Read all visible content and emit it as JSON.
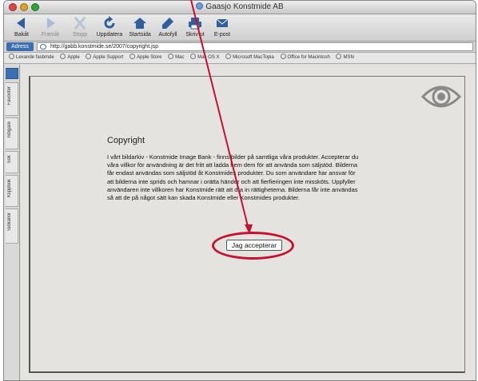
{
  "window": {
    "title": "Gaasjo Konstmide AB",
    "traffic_light_colors": [
      "#e0443e",
      "#dea123",
      "#2ea334"
    ]
  },
  "toolbar": {
    "back": "Bakåt",
    "forward": "Framåt",
    "stop": "Stopp",
    "refresh": "Uppdatera",
    "home": "Startsida",
    "autofill": "Autofyll",
    "print": "Skriv ut",
    "mail": "E-post"
  },
  "address": {
    "label": "Adress",
    "url": "http://gabb.konstmide.se/2007/copyright.jsp"
  },
  "favorites": [
    "Levande fasbmde",
    "Apple",
    "Apple Support",
    "Apple Store",
    "Mac",
    "Mac OS X",
    "Microsoft MacTopia",
    "Office for Macintosh",
    "MSN"
  ],
  "sidebar_tabs": [
    "Favoriter",
    "Tidigare",
    "Sök",
    "Klippbok",
    "Sidkällor"
  ],
  "page": {
    "heading": "Copyright",
    "body": "I vårt bildarkiv - Konstmide Image Bank - finns bilder på samtliga våra produkter. Accepterar du våra villkor för användning är det fritt att ladda hem dem för att använda som säljstöd. Bilderna får endast användas som säljstöd åt Konstmides produkter. Du som användare har ansvar för att bilderna inte sprids och hamnar i orätta händer och att fierfieringen inte missköts. Uppfyller användaren inte villkoren har Konstmide rätt att dra in rättigheterna. Bilderna får inte användas så att de på något sätt kan skada Konstmide eller Konstmides produkter.",
    "accept_button": "Jag accepterar"
  },
  "annotation": {
    "color": "#c8102e"
  }
}
